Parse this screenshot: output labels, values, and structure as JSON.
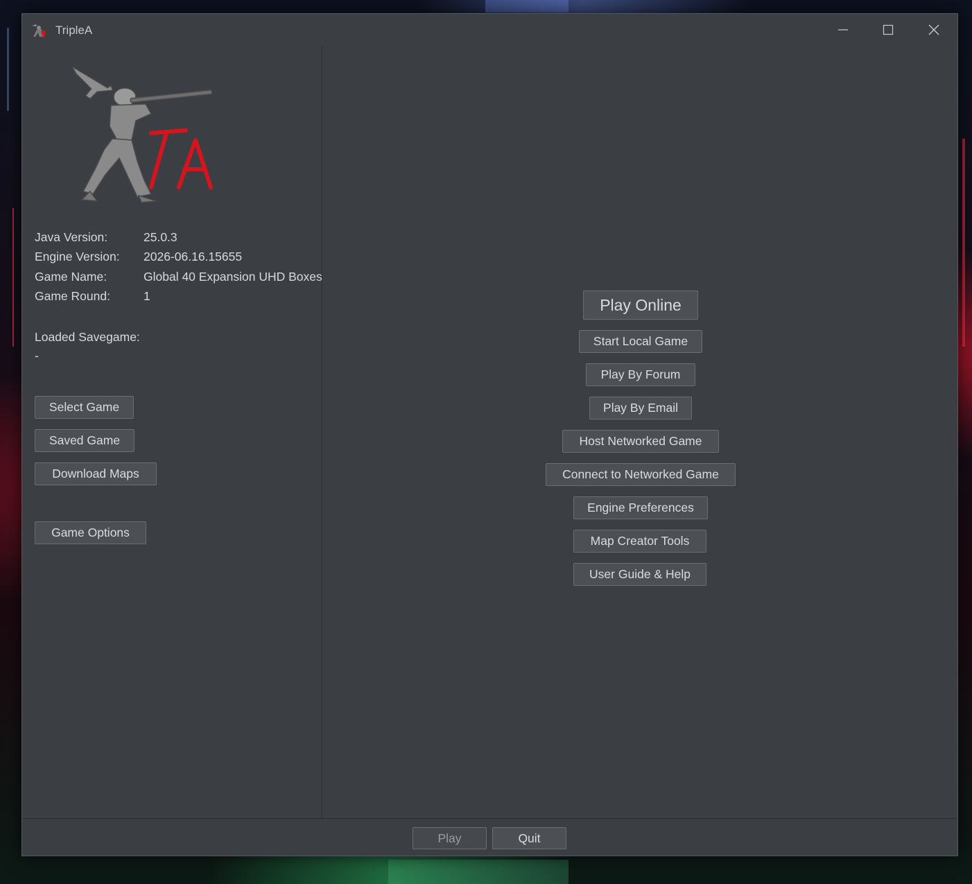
{
  "window": {
    "title": "TripleA"
  },
  "titlebar_controls": [
    {
      "name": "minimize-icon"
    },
    {
      "name": "maximize-icon"
    },
    {
      "name": "close-icon"
    }
  ],
  "logo": {
    "text": "TA",
    "accent_color": "#d4141e"
  },
  "info": {
    "java_label": "Java Version:",
    "java_value": "25.0.3",
    "engine_label": "Engine Version:",
    "engine_value": "2026-06.16.15655",
    "game_name_label": "Game Name:",
    "game_name_value": "Global 40 Expansion UHD Boxes",
    "round_label": "Game Round:",
    "round_value": "1",
    "savegame_label": "Loaded Savegame:",
    "savegame_value": "-"
  },
  "left_buttons": {
    "select_game": "Select Game",
    "saved_game": "Saved Game",
    "download_maps": "Download Maps",
    "game_options": "Game Options"
  },
  "main_buttons": {
    "play_online": "Play Online",
    "start_local": "Start Local Game",
    "play_forum": "Play By Forum",
    "play_email": "Play By Email",
    "host_network": "Host Networked Game",
    "connect_network": "Connect to Networked Game",
    "engine_prefs": "Engine Preferences",
    "map_tools": "Map Creator Tools",
    "user_guide": "User Guide & Help"
  },
  "bottom_buttons": {
    "play": "Play",
    "quit": "Quit"
  }
}
